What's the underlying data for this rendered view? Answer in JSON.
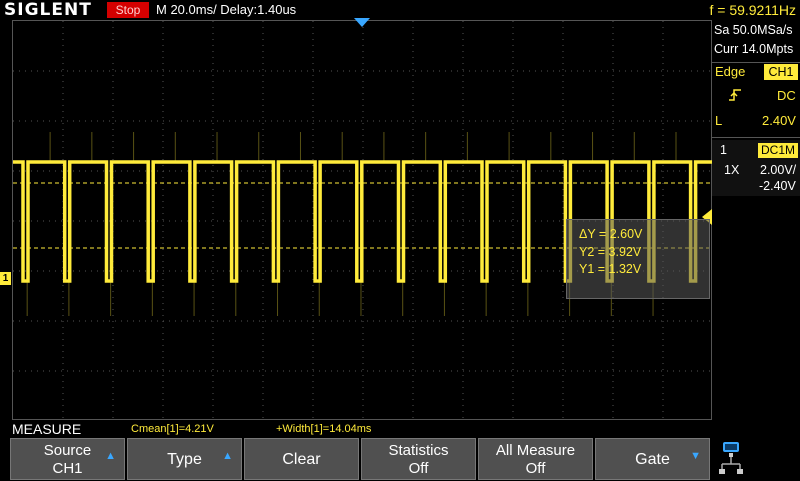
{
  "header": {
    "brand": "SIGLENT",
    "run_state": "Stop",
    "timebase": "M 20.0ms/ Delay:1.40us",
    "frequency": "f = 59.9211Hz"
  },
  "acquisition": {
    "sample_rate": "Sa 50.0MSa/s",
    "memory": "Curr 14.0Mpts"
  },
  "trigger": {
    "type": "Edge",
    "source": "CH1",
    "slope_icon": "rising-edge-icon",
    "coupling": "DC",
    "level_label": "L",
    "level": "2.40V"
  },
  "channel": {
    "number": "1",
    "coupling": "DC1M",
    "probe": "1X",
    "scale": "2.00V/",
    "offset": "-2.40V"
  },
  "cursors": {
    "delta_y": "ΔY = 2.60V",
    "y2": "Y2 = 3.92V",
    "y1": "Y1 = 1.32V"
  },
  "measure": {
    "title": "MEASURE",
    "cmean": "Cmean[1]=4.21V",
    "width": "+Width[1]=14.04ms"
  },
  "softkeys": [
    {
      "line1": "Source",
      "line2": "CH1",
      "has_arrow": true
    },
    {
      "line1": "Type",
      "line2": "",
      "has_arrow": true
    },
    {
      "line1": "Clear",
      "line2": "",
      "has_arrow": false
    },
    {
      "line1": "Statistics",
      "line2": "Off",
      "has_arrow": false
    },
    {
      "line1": "All Measure",
      "line2": "Off",
      "has_arrow": false
    },
    {
      "line1": "Gate",
      "line2": "",
      "has_arrow": true
    }
  ],
  "markers": {
    "channel_marker": "1"
  },
  "waveform": {
    "period_ms": 16.69,
    "high_v": 4.76,
    "low_v": 0.0,
    "ch1_offset_v": -2.4,
    "v_per_div": 2.0,
    "pulse_count": 17
  },
  "colors": {
    "ch1": "#ffeb3b",
    "stop": "#d40000",
    "accent": "#39a7ff"
  },
  "icons": {
    "trigger_position": "triangle-down-icon",
    "trigger_level": "triangle-left-icon",
    "network": "network-icon"
  }
}
